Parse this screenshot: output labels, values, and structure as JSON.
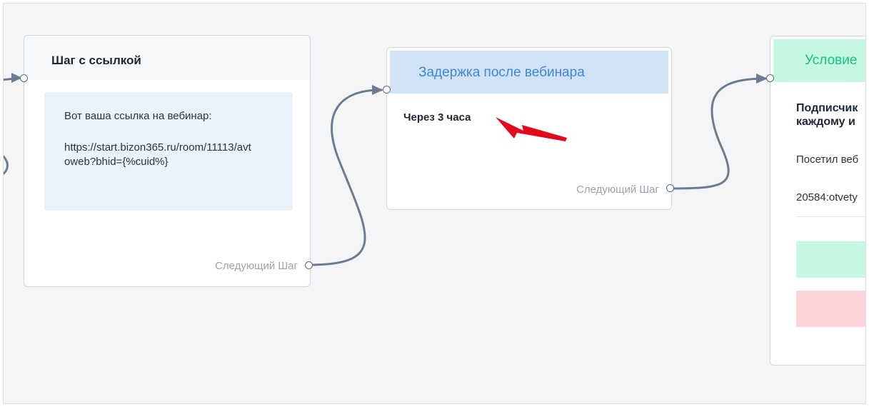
{
  "nodes": {
    "link_step": {
      "title": "Шаг с ссылкой",
      "message_line1": "Вот ваша ссылка на вебинар:",
      "message_line2": "https://start.bizon365.ru/room/11113/avt",
      "message_line3": "oweb?bhid={%cuid%}",
      "next_label": "Следующий Шаг"
    },
    "delay_step": {
      "title": "Задержка после вебинара",
      "delay_text": "Через 3 часа",
      "next_label": "Следующий Шаг"
    },
    "condition_step": {
      "title": "Условие",
      "heading_line1": "Подписчик",
      "heading_line2": "каждому и",
      "description": "Посетил веб",
      "value": "20584:otvety"
    }
  },
  "colors": {
    "delay_header": "#d2e3f8",
    "condition_header": "#c6f7e3",
    "condition_yes": "#c6f7e3",
    "condition_no": "#fdd6dc",
    "wire": "#6e7a91",
    "annotation_arrow": "#e3081b"
  },
  "icons": {
    "annotation": "red-arrow-pointer"
  }
}
